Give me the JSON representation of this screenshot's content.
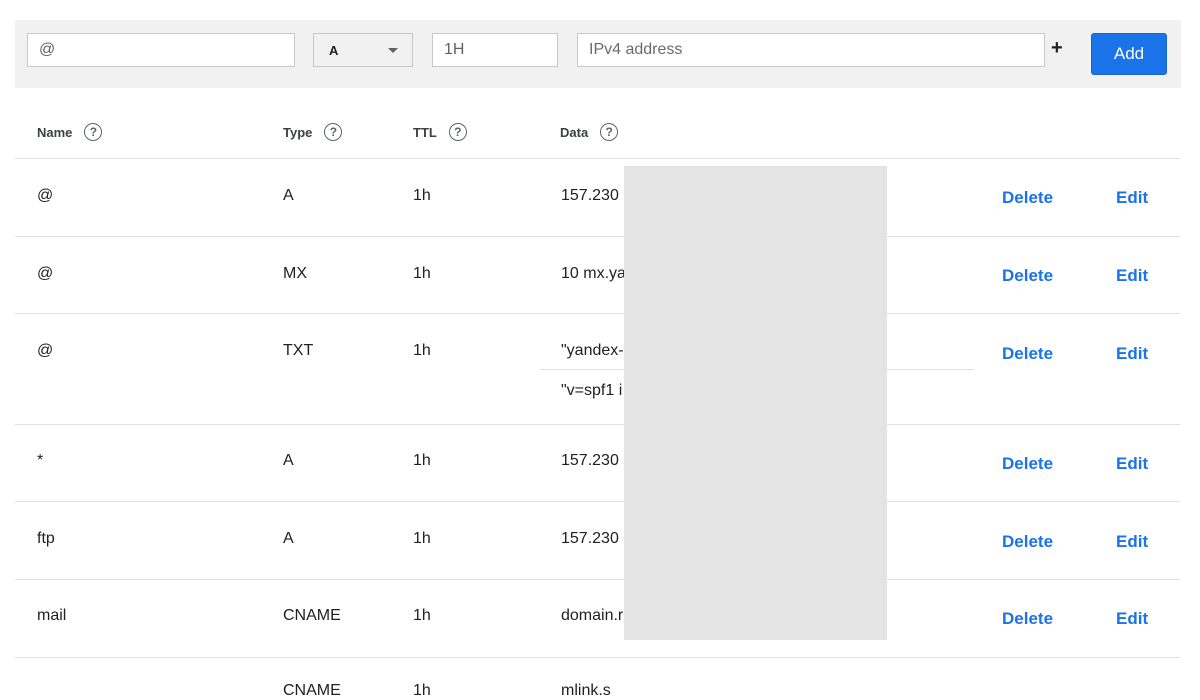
{
  "form": {
    "name_value": "@",
    "type_value": "A",
    "ttl_value": "1H",
    "data_placeholder": "IPv4 address",
    "plus_label": "+",
    "add_label": "Add"
  },
  "table": {
    "headers": {
      "name": "Name",
      "type": "Type",
      "ttl": "TTL",
      "data": "Data"
    },
    "help_glyph": "?",
    "action_delete": "Delete",
    "action_edit": "Edit",
    "rows": [
      {
        "name": "@",
        "type": "A",
        "ttl": "1h",
        "data": "157.230"
      },
      {
        "name": "@",
        "type": "MX",
        "ttl": "1h",
        "data": "10 mx.ya"
      },
      {
        "name": "@",
        "type": "TXT",
        "ttl": "1h",
        "data": "\"yandex-",
        "data2": "\"v=spf1 i"
      },
      {
        "name": "*",
        "type": "A",
        "ttl": "1h",
        "data": "157.230"
      },
      {
        "name": "ftp",
        "type": "A",
        "ttl": "1h",
        "data": "157.230"
      },
      {
        "name": "mail",
        "type": "CNAME",
        "ttl": "1h",
        "data": "domain.r"
      },
      {
        "name": "",
        "type": "CNAME",
        "ttl": "1h",
        "data": "mlink.s"
      }
    ]
  },
  "colors": {
    "accent": "#1a73e8",
    "form_bg": "#f1f1f1",
    "redaction": "#e4e4e4"
  }
}
